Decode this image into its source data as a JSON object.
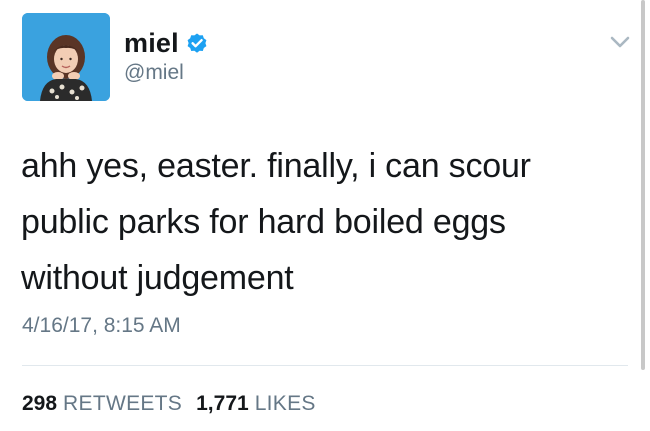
{
  "author": {
    "display_name": "miel",
    "handle": "@miel",
    "verified": true,
    "avatar_icon": "profile-photo"
  },
  "tweet": {
    "text": "ahh yes, easter. finally, i can scour public parks for hard boiled eggs without judgement",
    "timestamp": "4/16/17, 8:15 AM"
  },
  "stats": {
    "retweets_count": "298",
    "retweets_label": "RETWEETS",
    "likes_count": "1,771",
    "likes_label": "LIKES"
  },
  "icons": {
    "verified": "verified-badge-icon",
    "menu": "chevron-down-icon"
  },
  "colors": {
    "text_primary": "#14171a",
    "text_secondary": "#657786",
    "verified_blue": "#1da1f2",
    "avatar_bg": "#3aa2df",
    "divider": "#e1e8ed"
  }
}
